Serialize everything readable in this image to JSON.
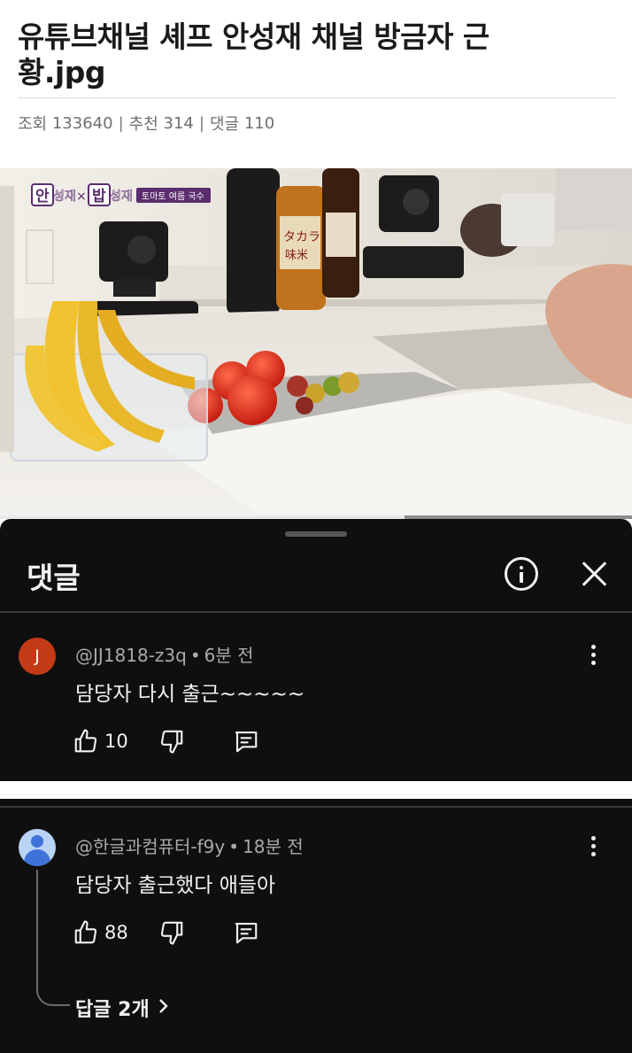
{
  "post": {
    "title": "유튜브채널 셰프 안성재 채널 방금자 근황.jpg",
    "views_label": "조회",
    "views": "133640",
    "recommend_label": "추천",
    "recommend": "314",
    "comments_label": "댓글",
    "comments": "110",
    "separator": "|"
  },
  "video": {
    "channel_logo_left": "안",
    "channel_logo_text1": "성재",
    "channel_logo_x": "×",
    "channel_logo_right": "밥",
    "channel_logo_text2": "성재",
    "episode_tag": "토마토 여름 국수",
    "bottle_label": "タカラ",
    "bottle_label2": "味米",
    "progress": 0.64
  },
  "comments_sheet": {
    "title": "댓글",
    "comments": [
      {
        "avatar_letter": "J",
        "author": "@JJ1818-z3q",
        "dot": "•",
        "time": "6분 전",
        "text": "담당자 다시 출근~~~~~",
        "likes": "10"
      },
      {
        "author": "@한글과컴퓨터-f9y",
        "dot": "•",
        "time": "18분 전",
        "text": "담당자 출근했다 애들아",
        "likes": "88",
        "replies": "답글 2개"
      }
    ]
  },
  "icons": [
    "info-icon",
    "close-icon",
    "more-vert-icon",
    "thumb-up-icon",
    "thumb-down-icon",
    "reply-icon",
    "chevron-right-icon",
    "default-avatar-icon"
  ],
  "colors": {
    "sheet_bg": "#0f0f0f",
    "avatar_j": "#c33b16",
    "avatar_default": "#3f72d6"
  }
}
